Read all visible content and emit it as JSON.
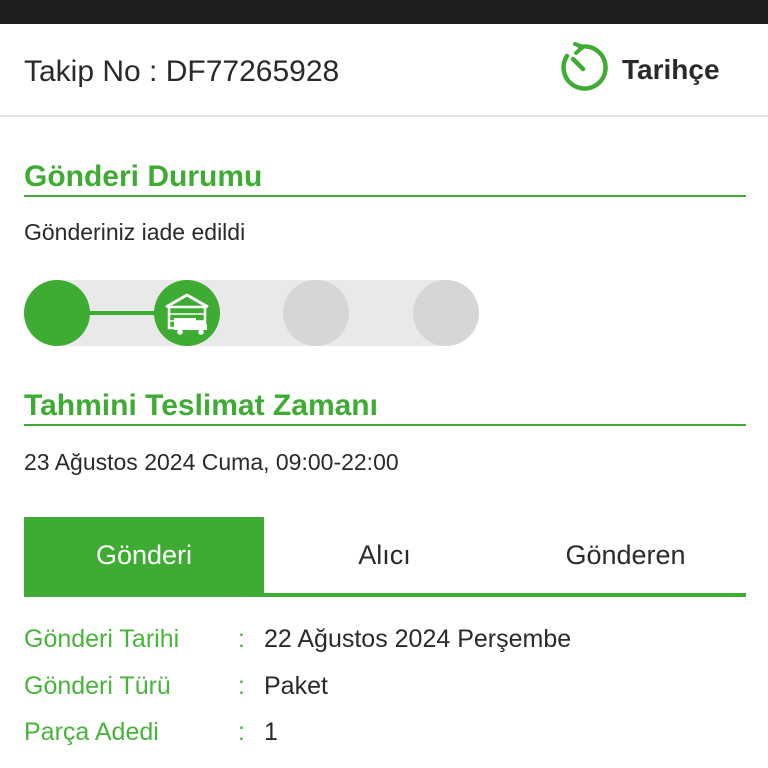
{
  "header": {
    "tracking_label": "Takip No : DF77265928",
    "history_label": "Tarihçe",
    "history_icon": "clock-history-icon"
  },
  "status_section": {
    "title": "Gönderi Durumu",
    "message": "Gönderiniz iade edildi",
    "steps_total": 4,
    "steps_completed": 2,
    "current_step_icon": "warehouse-truck-icon"
  },
  "delivery_section": {
    "title": "Tahmini Teslimat Zamanı",
    "estimate": "23 Ağustos 2024 Cuma, 09:00-22:00"
  },
  "tabs": [
    {
      "label": "Gönderi",
      "active": true
    },
    {
      "label": "Alıcı",
      "active": false
    },
    {
      "label": "Gönderen",
      "active": false
    }
  ],
  "details": [
    {
      "label": "Gönderi Tarihi",
      "value": "22 Ağustos 2024 Perşembe"
    },
    {
      "label": "Gönderi Türü",
      "value": "Paket"
    },
    {
      "label": "Parça Adedi",
      "value": "1"
    }
  ],
  "detail_separator": ":",
  "colors": {
    "accent": "#3eab32",
    "pending_step": "#d6d6d6",
    "track": "#e9e9e9",
    "status_bar": "#1e1e1e"
  }
}
